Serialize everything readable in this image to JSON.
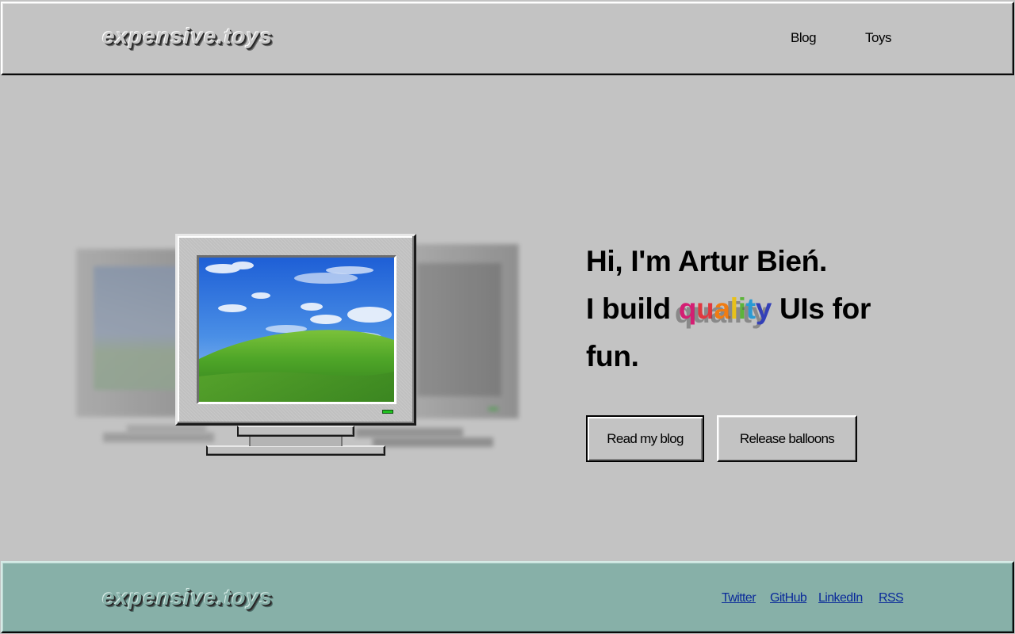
{
  "header": {
    "logo": "expensive.toys",
    "nav": [
      {
        "label": "Blog"
      },
      {
        "label": "Toys"
      }
    ]
  },
  "hero": {
    "line1": "Hi, I'm Artur Bień.",
    "line2_prefix": "I build ",
    "highlight_letters": [
      "q",
      "u",
      "a",
      "l",
      "i",
      "t",
      "y"
    ],
    "line2_suffix": " UIs for",
    "line3": "fun.",
    "buttons": {
      "read_blog": "Read my blog",
      "release_balloons": "Release balloons"
    },
    "highlight_colors": [
      "#d41e73",
      "#e0383f",
      "#f07c12",
      "#e8c11a",
      "#5cb43a",
      "#2a9bd4",
      "#3340b8"
    ]
  },
  "illustration": {
    "icon": "crt-monitor-icon",
    "wallpaper": "bliss-hill-image"
  },
  "footer": {
    "logo": "expensive.toys",
    "links": [
      {
        "label": "Twitter"
      },
      {
        "label": "GitHub"
      },
      {
        "label": "LinkedIn"
      },
      {
        "label": "RSS"
      }
    ]
  },
  "colors": {
    "background": "#c3c3c3",
    "footer": "#87b0a8",
    "link": "#0a2a9a",
    "led": "#20c020"
  }
}
